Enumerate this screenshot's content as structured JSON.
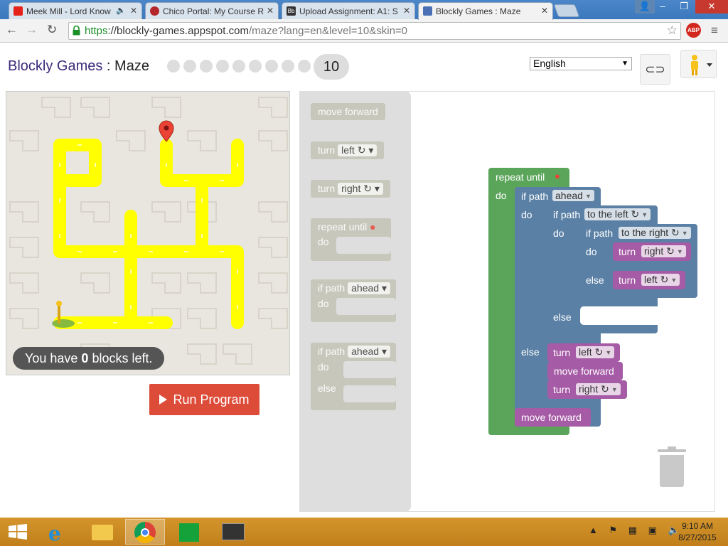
{
  "browser": {
    "tabs": [
      {
        "title": "Meek Mill - Lord Know",
        "icon": "youtube-icon",
        "color": "#e62117",
        "audio": "speaker-icon"
      },
      {
        "title": "Chico Portal: My Course R",
        "icon": "chico-icon",
        "color": "#b3262b"
      },
      {
        "title": "Upload Assignment: A1: S",
        "icon": "blackboard-icon",
        "color": "#333333"
      },
      {
        "title": "Blockly Games : Maze",
        "icon": "blockly-icon",
        "color": "#4a6fb5"
      }
    ],
    "close_glyph": "✕",
    "url_https": "https",
    "url_host": "://blockly-games.appspot.com",
    "url_path": "/maze?lang=en&level=10&skin=0",
    "abp_label": "ABP"
  },
  "header": {
    "app_name": "Blockly Games",
    "separator": " : ",
    "game_name": "Maze",
    "current_level": "10",
    "language": "English"
  },
  "maze": {
    "blocks_left_prefix": "You have ",
    "blocks_left_count": "0",
    "blocks_left_suffix": " blocks left."
  },
  "run_button": "Run Program",
  "flyout": {
    "move_forward": "move forward",
    "turn": "turn",
    "left": "left",
    "right": "right",
    "repeat_until": "repeat until",
    "do": "do",
    "if_path": "if path",
    "ahead": "ahead",
    "else": "else"
  },
  "program": {
    "repeat_until": "repeat until",
    "do": "do",
    "if_path": "if path",
    "ahead": "ahead",
    "to_the_left": "to the left",
    "to_the_right": "to the right",
    "turn": "turn",
    "right": "right",
    "left": "left",
    "else": "else",
    "move_forward": "move forward"
  },
  "taskbar": {
    "time": "9:10 AM",
    "date": "8/27/2015"
  },
  "colors": {
    "loop": "#5ba55b",
    "logic": "#5b80a5",
    "movement": "#a55ba5",
    "maze_path": "#ffff00",
    "run": "#dd4b39"
  }
}
